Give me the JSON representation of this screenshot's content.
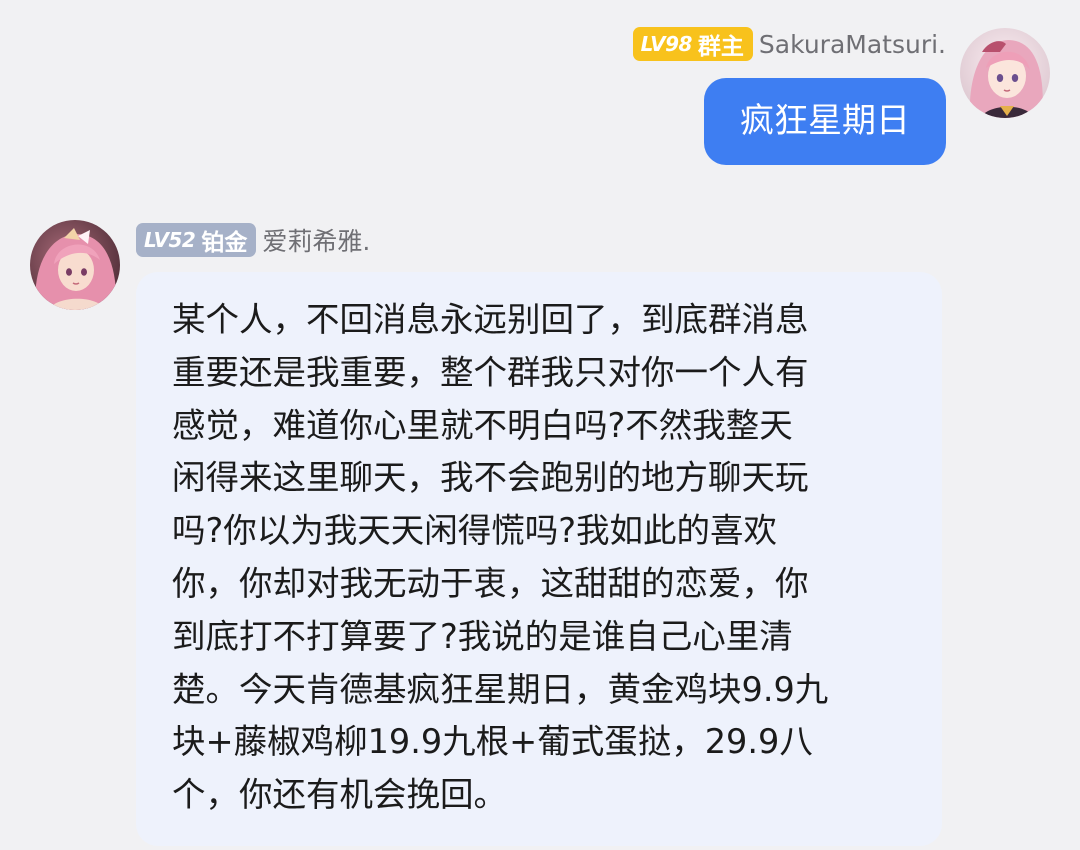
{
  "messages": [
    {
      "direction": "outgoing",
      "level_label": "LV98",
      "badge_text": "群主",
      "badge_color": "#f8c21c",
      "sender": "SakuraMatsuri.",
      "text": "疯狂星期日",
      "bubble_color": "#3e7ef2",
      "avatar_icon": "avatar-pink-hair-girl"
    },
    {
      "direction": "incoming",
      "level_label": "LV52",
      "badge_text": "铂金",
      "badge_color": "#a6b1c8",
      "sender": "爱莉希雅.",
      "bubble_color": "#eef2fc",
      "avatar_icon": "avatar-pink-hair-girl",
      "lines": [
        "某个人，不回消息永远别回了，到底群消息",
        "重要还是我重要，整个群我只对你一个人有",
        "感觉，难道你心里就不明白吗?不然我整天",
        "闲得来这里聊天，我不会跑别的地方聊天玩",
        "吗?你以为我天天闲得慌吗?我如此的喜欢",
        "你，你却对我无动于衷，这甜甜的恋爱，你",
        "到底打不打算要了?我说的是谁自己心里清",
        "楚。今天肯德基疯狂星期日，黄金鸡块9.9九",
        "块+藤椒鸡柳19.9九根+葡式蛋挞，29.9八",
        "个，你还有机会挽回。"
      ]
    }
  ]
}
